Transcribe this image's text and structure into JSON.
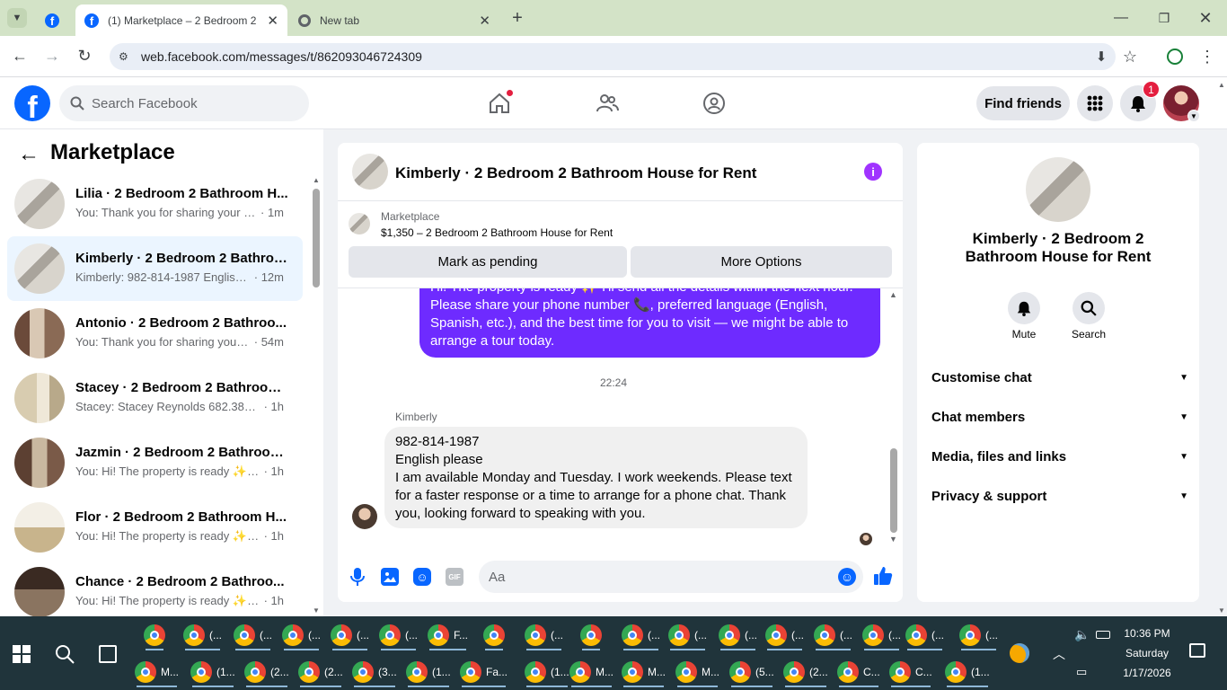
{
  "browser": {
    "tabs": [
      {
        "title": "",
        "icon": "facebook-icon"
      },
      {
        "title": "(1) Marketplace – 2 Bedroom 2",
        "icon": "facebook-icon"
      },
      {
        "title": "New tab",
        "icon": "chrome-icon"
      }
    ],
    "url": "web.facebook.com/messages/t/862093046724309"
  },
  "fb": {
    "search_placeholder": "Search Facebook",
    "find_friends": "Find friends",
    "notification_count": "1"
  },
  "marketplace": {
    "title": "Marketplace",
    "conversations": [
      {
        "name": "Lilia · 2 Bedroom 2 Bathroom H...",
        "preview": "You: Thank you for sharing your nu...",
        "time": "· 1m",
        "selected": false
      },
      {
        "name": "Kimberly · 2 Bedroom 2 Bathroo...",
        "preview": "Kimberly: 982-814-1987 English p...",
        "time": "· 12m",
        "selected": true
      },
      {
        "name": "Antonio · 2 Bedroom 2 Bathroo...",
        "preview": "You: Thank you for sharing your n...",
        "time": "· 54m",
        "selected": false
      },
      {
        "name": "Stacey · 2 Bedroom 2 Bathroom ...",
        "preview": "Stacey: Stacey Reynolds 682.381.76...",
        "time": "· 1h",
        "selected": false
      },
      {
        "name": "Jazmin · 2 Bedroom 2 Bathroom...",
        "preview": "You: Hi! The property is ready ✨ I'l...",
        "time": "· 1h",
        "selected": false
      },
      {
        "name": "Flor · 2 Bedroom 2 Bathroom H...",
        "preview": "You: Hi! The property is ready ✨ I'l...",
        "time": "· 1h",
        "selected": false
      },
      {
        "name": "Chance · 2 Bedroom 2 Bathroo...",
        "preview": "You: Hi! The property is ready ✨ I'l...",
        "time": "· 1h",
        "selected": false
      }
    ]
  },
  "chat": {
    "title": "Kimberly · 2 Bedroom 2 Bathroom House for Rent",
    "listing_source": "Marketplace",
    "listing_price": "$1,350 – 2 Bedroom 2 Bathroom House for Rent",
    "mark_pending": "Mark as pending",
    "more_options": "More Options",
    "outgoing_lines": [
      "Hi! The property is ready ✨ I'll send all the details within the next hour.",
      "Please share your phone number 📞, preferred language (English,",
      "Spanish, etc.), and the best time for you to visit — we might be able to",
      "arrange a tour today."
    ],
    "timestamp": "22:24",
    "sender": "Kimberly",
    "incoming_lines": [
      "982-814-1987",
      "English please",
      "I am available Monday and Tuesday. I work weekends. Please text",
      "for a faster response or a time to arrange for a phone chat. Thank",
      "you, looking forward to speaking with you."
    ],
    "composer_placeholder": "Aa"
  },
  "info": {
    "title_line1": "Kimberly · 2 Bedroom 2",
    "title_line2": "Bathroom House for Rent",
    "mute": "Mute",
    "search": "Search",
    "sections": [
      "Customise chat",
      "Chat members",
      "Media, files and links",
      "Privacy & support"
    ]
  },
  "taskbar": {
    "row1": [
      "",
      "(...",
      "(...",
      "(...",
      "(...",
      "(...",
      "F...",
      "",
      "(...",
      "",
      "(...",
      "(...",
      "(...",
      "(...",
      "(...",
      "(...",
      "(...",
      "(...",
      ""
    ],
    "row2": [
      "M...",
      "(1...",
      "(2...",
      "(2...",
      "(3...",
      "(1...",
      "Fa...",
      "(1...",
      "M...",
      "M...",
      "M...",
      "(5...",
      "(2...",
      "C...",
      "C...",
      "(1..."
    ],
    "time": "10:36 PM",
    "day": "Saturday",
    "date": "1/17/2026"
  },
  "colors": {
    "facebook_blue": "#0866ff",
    "messenger_purple": "#6e2bff",
    "selected_row": "#ebf5ff",
    "taskbar": "#20343b"
  }
}
